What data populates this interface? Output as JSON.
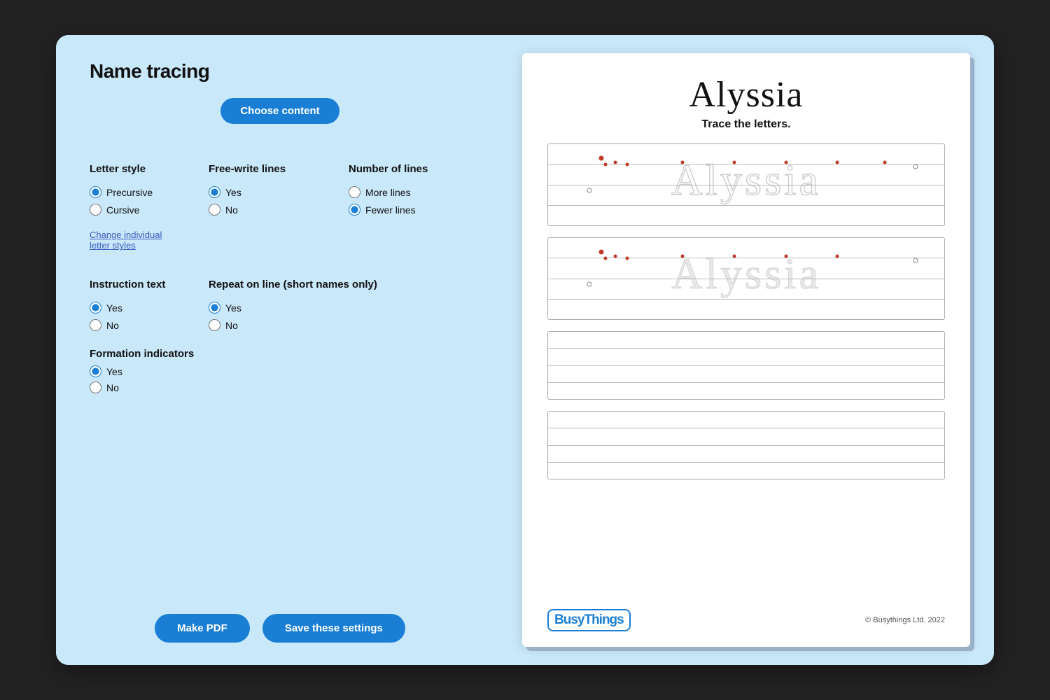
{
  "app": {
    "title": "Name tracing",
    "background_color": "#c9e8fa"
  },
  "left_panel": {
    "title": "Name tracing",
    "choose_content_button": "Choose content",
    "letter_style": {
      "label": "Letter style",
      "options": [
        {
          "id": "precursive",
          "label": "Precursive",
          "selected": true
        },
        {
          "id": "cursive",
          "label": "Cursive",
          "selected": false
        }
      ]
    },
    "free_write_lines": {
      "label": "Free-write lines",
      "options": [
        {
          "id": "fw-yes",
          "label": "Yes",
          "selected": true
        },
        {
          "id": "fw-no",
          "label": "No",
          "selected": false
        }
      ]
    },
    "number_of_lines": {
      "label": "Number of lines",
      "options": [
        {
          "id": "more-lines",
          "label": "More lines",
          "selected": false
        },
        {
          "id": "fewer-lines",
          "label": "Fewer lines",
          "selected": true
        }
      ]
    },
    "change_link": "Change individual\nletter styles",
    "instruction_text": {
      "label": "Instruction text",
      "options": [
        {
          "id": "it-yes",
          "label": "Yes",
          "selected": true
        },
        {
          "id": "it-no",
          "label": "No",
          "selected": false
        }
      ]
    },
    "repeat_on_line": {
      "label": "Repeat on line (short names only)",
      "options": [
        {
          "id": "rl-yes",
          "label": "Yes",
          "selected": true
        },
        {
          "id": "rl-no",
          "label": "No",
          "selected": false
        }
      ]
    },
    "formation_indicators": {
      "label": "Formation indicators",
      "options": [
        {
          "id": "fi-yes",
          "label": "Yes",
          "selected": true
        },
        {
          "id": "fi-no",
          "label": "No",
          "selected": false
        }
      ]
    },
    "make_pdf_button": "Make PDF",
    "save_settings_button": "Save these settings"
  },
  "right_panel": {
    "name": "Alyssia",
    "subtitle": "Trace the letters.",
    "footer": {
      "logo": "BusyThings",
      "copyright": "© Busythings Ltd. 2022"
    }
  }
}
